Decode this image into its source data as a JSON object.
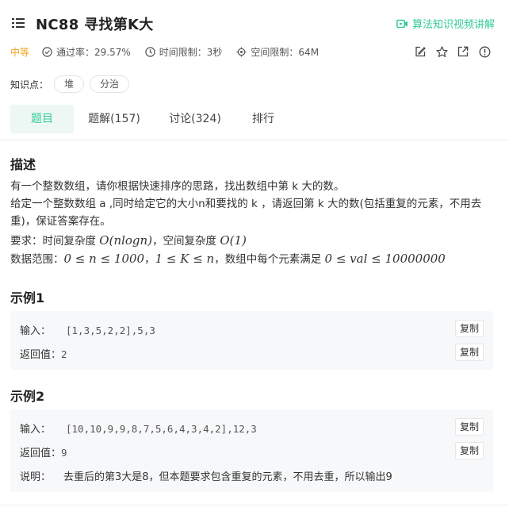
{
  "header": {
    "title": "NC88  寻找第K大",
    "video_link": "算法知识视频讲解",
    "accent": "#32ca99"
  },
  "meta": {
    "difficulty": "中等",
    "pass_rate": "通过率：29.57%",
    "time_limit": "时间限制：3秒",
    "space_limit": "空间限制：64M"
  },
  "tags": {
    "label": "知识点：",
    "items": [
      "堆",
      "分治"
    ]
  },
  "tabs": [
    "题目",
    "题解(157)",
    "讨论(324)",
    "排行"
  ],
  "description": {
    "heading": "描述",
    "line1": "有一个整数数组，请你根据快速排序的思路，找出数组中第 k 大的数。",
    "line2": "给定一个整数数组 a ,同时给定它的大小n和要找的 k ，请返回第 k 大的数(包括重复的元素，不用去重)，保证答案存在。",
    "req_prefix": "要求：时间复杂度 ",
    "req_time": "O(nlogn)",
    "req_mid": "，空间复杂度 ",
    "req_space": "O(1)",
    "range_prefix": "数据范围：",
    "range_n": "0 ≤ n ≤ 1000",
    "range_sep": "，",
    "range_k": "1 ≤ K ≤ n",
    "range_mid": "，数组中每个元素满足 ",
    "range_val": "0 ≤ val ≤ 10000000"
  },
  "example1": {
    "heading": "示例1",
    "input_label": "输入：",
    "input_value": "[1,3,5,2,2],5,3",
    "output_label": "返回值：",
    "output_value": "2",
    "copy": "复制"
  },
  "example2": {
    "heading": "示例2",
    "input_label": "输入：",
    "input_value": "[10,10,9,9,8,7,5,6,4,3,4,2],12,3",
    "output_label": "返回值：",
    "output_value": "9",
    "explain_label": "说明：",
    "explain_value": "去重后的第3大是8，但本题要求包含重复的元素，不用去重，所以输出9",
    "copy": "复制"
  },
  "icons": {
    "menu": "list-icon",
    "video": "video-icon",
    "pass_rate": "check-circle-icon",
    "time": "clock-icon",
    "space": "chip-icon",
    "edit": "edit-icon",
    "star": "star-icon",
    "share": "external-link-icon",
    "info": "info-icon"
  }
}
